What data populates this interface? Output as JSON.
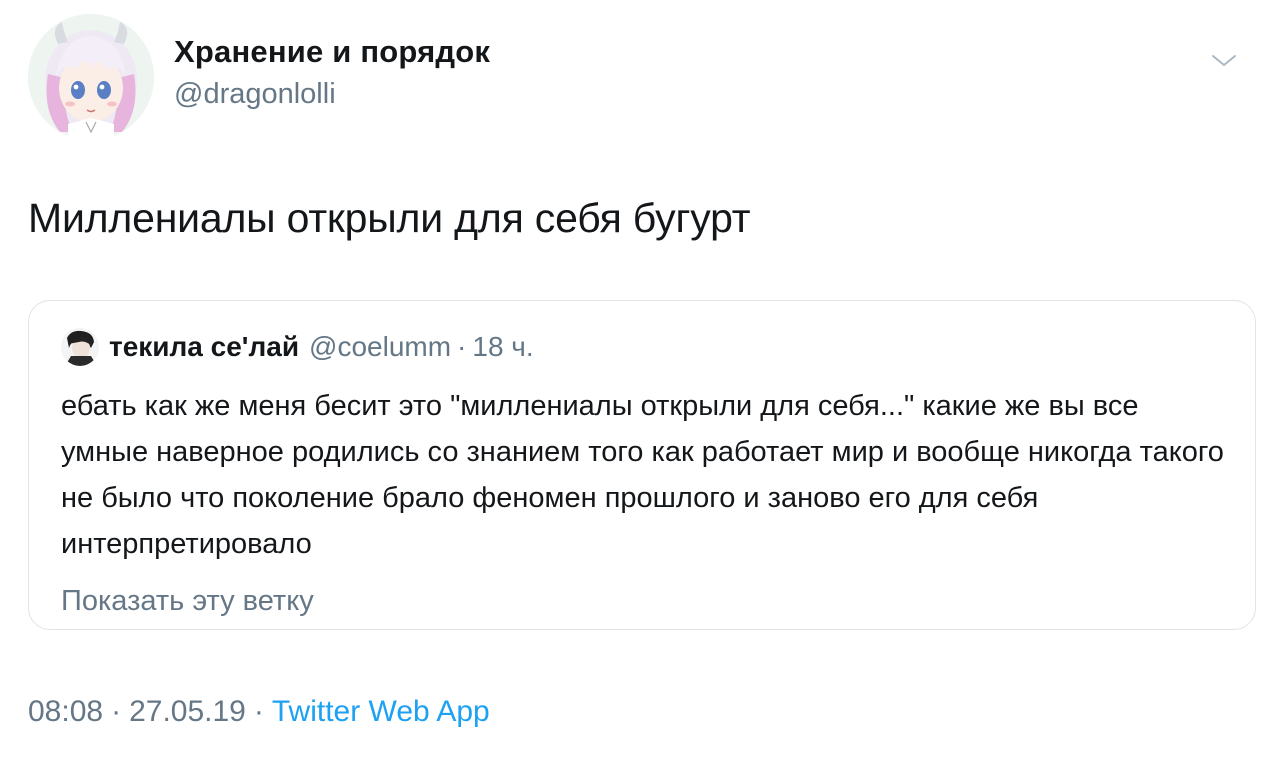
{
  "tweet": {
    "author": {
      "display_name": "Хранение и порядок",
      "handle": "@dragonlolli"
    },
    "text": "Миллениалы открыли для себя бугурт",
    "menu_icon": "chevron-down-icon",
    "quoted": {
      "author_name": "текила се'лай",
      "author_handle": "@coelumm",
      "separator": "·",
      "time": "18 ч.",
      "text": "ебать как же меня бесит это \"миллениалы открыли для себя...\" какие же вы все умные наверное родились со знанием того как работает мир и вообще никогда такого не было что поколение брало феномен прошлого и заново его для себя интерпретировало",
      "show_thread_label": "Показать эту ветку"
    },
    "meta": {
      "time": "08:08",
      "separator": "·",
      "date": "27.05.19",
      "source": "Twitter Web App"
    }
  },
  "colors": {
    "text_primary": "#14171a",
    "text_secondary": "#657786",
    "link": "#1da1f2",
    "border": "#dfe4e8"
  }
}
